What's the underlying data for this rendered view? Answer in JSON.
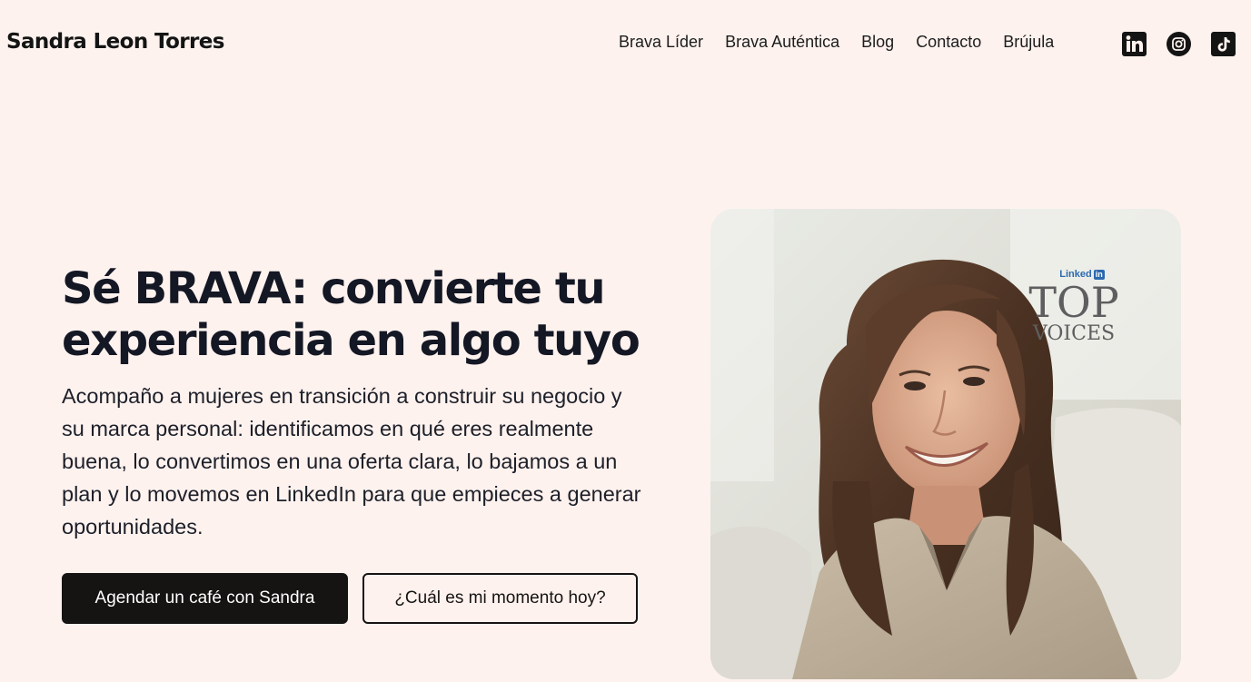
{
  "header": {
    "brand": "Sandra Leon Torres",
    "nav": [
      {
        "label": "Brava Líder"
      },
      {
        "label": "Brava Auténtica"
      },
      {
        "label": "Blog"
      },
      {
        "label": "Contacto"
      },
      {
        "label": "Brújula"
      }
    ],
    "social": [
      {
        "icon": "linkedin-icon"
      },
      {
        "icon": "instagram-icon"
      },
      {
        "icon": "tiktok-icon"
      }
    ]
  },
  "hero": {
    "title": "Sé BRAVA: convierte tu experiencia en algo tuyo",
    "description": "Acompaño a mujeres en transición a construir su negocio y su marca personal: identificamos en qué eres realmente buena, lo convertimos en una oferta clara, lo bajamos a un plan y lo movemos en LinkedIn para que empieces a generar oportunidades.",
    "primary_cta": "Agendar un café con Sandra",
    "secondary_cta": "¿Cuál es mi momento hoy?"
  },
  "photo_badge": {
    "brand_word": "Linked",
    "brand_box": "in",
    "line1": "TOP",
    "line2": "VOICES"
  },
  "colors": {
    "background": "#fdf2ee",
    "primary_button": "#161413",
    "linkedin_blue": "#2b69b0"
  }
}
